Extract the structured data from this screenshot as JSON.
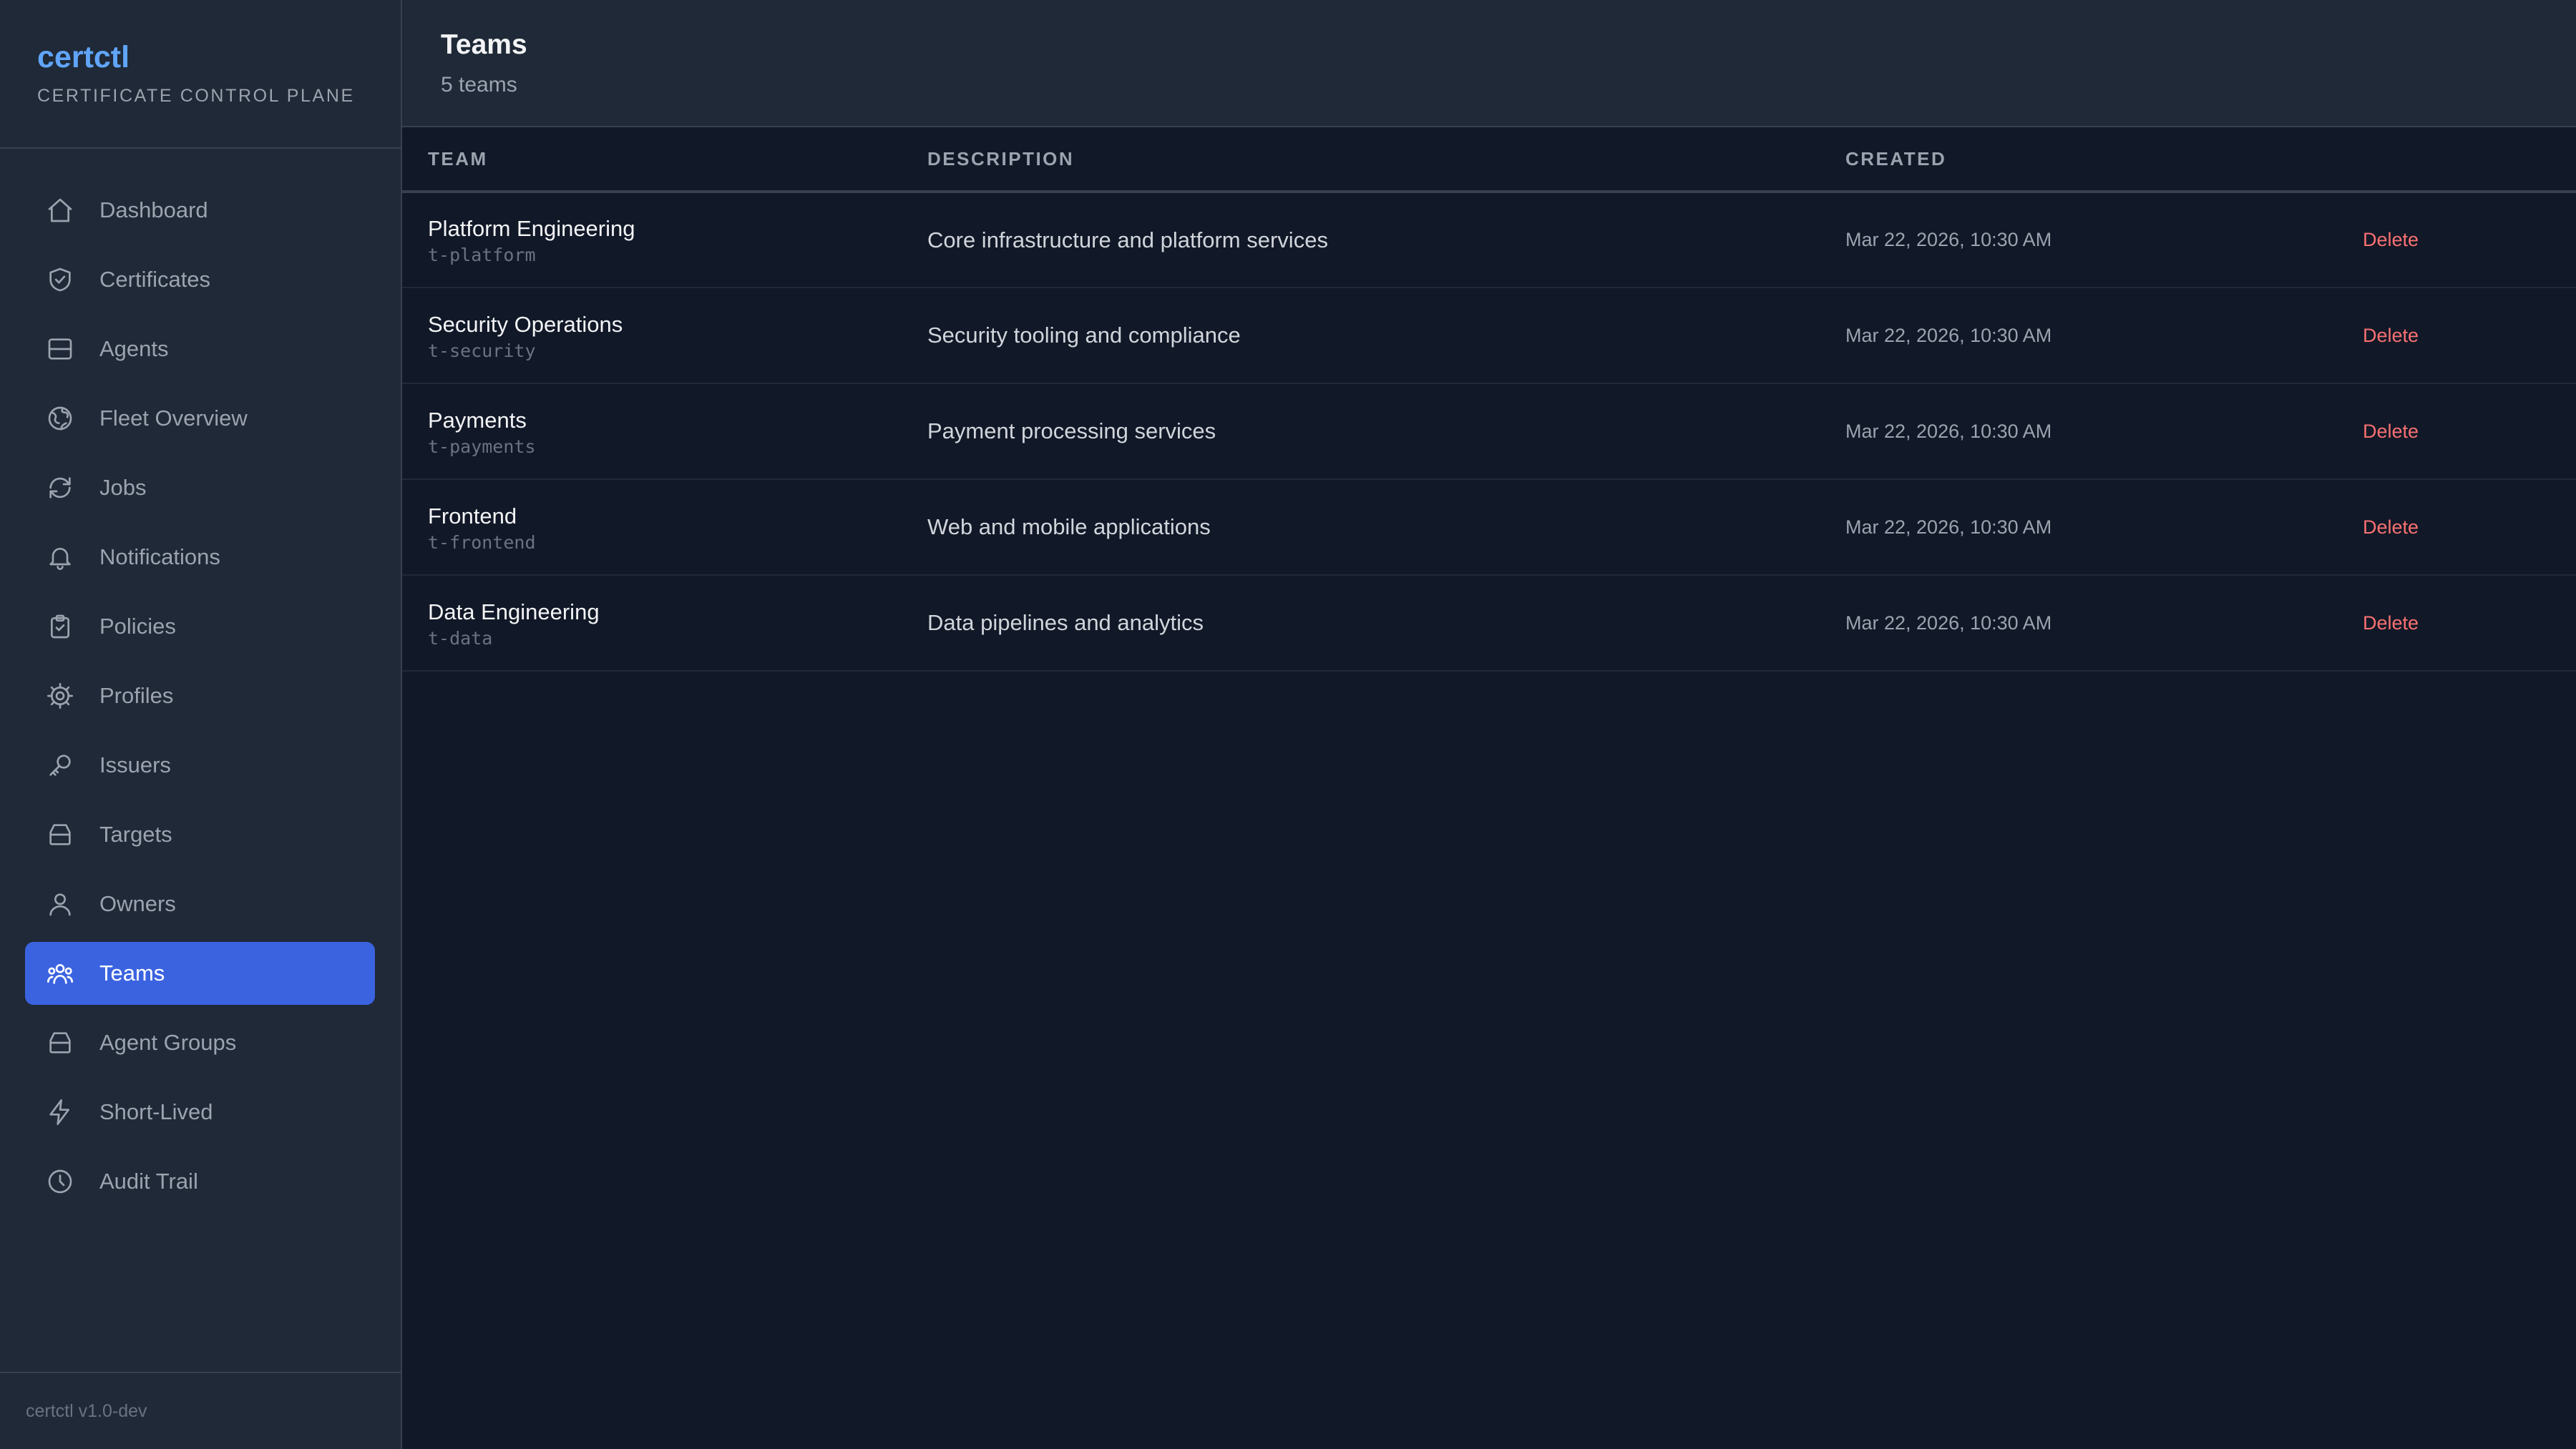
{
  "brand": {
    "name": "certctl",
    "subtitle": "CERTIFICATE CONTROL PLANE"
  },
  "nav": [
    {
      "label": "Dashboard",
      "icon": "home-icon",
      "active": false
    },
    {
      "label": "Certificates",
      "icon": "shield-check-icon",
      "active": false
    },
    {
      "label": "Agents",
      "icon": "server-icon",
      "active": false
    },
    {
      "label": "Fleet Overview",
      "icon": "globe-icon",
      "active": false
    },
    {
      "label": "Jobs",
      "icon": "refresh-icon",
      "active": false
    },
    {
      "label": "Notifications",
      "icon": "bell-icon",
      "active": false
    },
    {
      "label": "Policies",
      "icon": "clipboard-check-icon",
      "active": false
    },
    {
      "label": "Profiles",
      "icon": "gear-icon",
      "active": false
    },
    {
      "label": "Issuers",
      "icon": "key-icon",
      "active": false
    },
    {
      "label": "Targets",
      "icon": "stack-icon",
      "active": false
    },
    {
      "label": "Owners",
      "icon": "user-icon",
      "active": false
    },
    {
      "label": "Teams",
      "icon": "users-icon",
      "active": true
    },
    {
      "label": "Agent Groups",
      "icon": "stack-icon",
      "active": false
    },
    {
      "label": "Short-Lived",
      "icon": "bolt-icon",
      "active": false
    },
    {
      "label": "Audit Trail",
      "icon": "clock-icon",
      "active": false
    }
  ],
  "footer": {
    "version": "certctl v1.0-dev"
  },
  "page": {
    "title": "Teams",
    "count": "5 teams"
  },
  "table": {
    "headers": {
      "team": "TEAM",
      "description": "DESCRIPTION",
      "created": "CREATED",
      "actions": ""
    },
    "rows": [
      {
        "name": "Platform Engineering",
        "id": "t-platform",
        "description": "Core infrastructure and platform services",
        "created": "Mar 22, 2026, 10:30 AM",
        "action": "Delete"
      },
      {
        "name": "Security Operations",
        "id": "t-security",
        "description": "Security tooling and compliance",
        "created": "Mar 22, 2026, 10:30 AM",
        "action": "Delete"
      },
      {
        "name": "Payments",
        "id": "t-payments",
        "description": "Payment processing services",
        "created": "Mar 22, 2026, 10:30 AM",
        "action": "Delete"
      },
      {
        "name": "Frontend",
        "id": "t-frontend",
        "description": "Web and mobile applications",
        "created": "Mar 22, 2026, 10:30 AM",
        "action": "Delete"
      },
      {
        "name": "Data Engineering",
        "id": "t-data",
        "description": "Data pipelines and analytics",
        "created": "Mar 22, 2026, 10:30 AM",
        "action": "Delete"
      }
    ]
  },
  "colors": {
    "accent": "#3b63e0",
    "brand": "#60a5fa",
    "danger": "#f87171",
    "sidebar_bg": "#1f2937",
    "main_bg": "#111827"
  }
}
